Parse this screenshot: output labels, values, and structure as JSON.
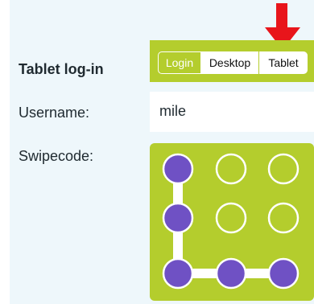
{
  "form": {
    "title": "Tablet log-in",
    "username_label": "Username:",
    "username_value": "mile",
    "swipecode_label": "Swipecode:"
  },
  "device_tabs": [
    {
      "label": "Login"
    },
    {
      "label": "Desktop"
    },
    {
      "label": "Tablet"
    }
  ],
  "swipecode": {
    "grid_rows": 3,
    "grid_cols": 3,
    "pattern": [
      [
        0,
        0
      ],
      [
        1,
        0
      ],
      [
        2,
        0
      ],
      [
        2,
        1
      ],
      [
        2,
        2
      ]
    ]
  },
  "colors": {
    "accent_green": "#b4cd2d",
    "dot_active": "#6f51c4",
    "arrow": "#e8151b",
    "page_bg": "#eef7fb"
  }
}
